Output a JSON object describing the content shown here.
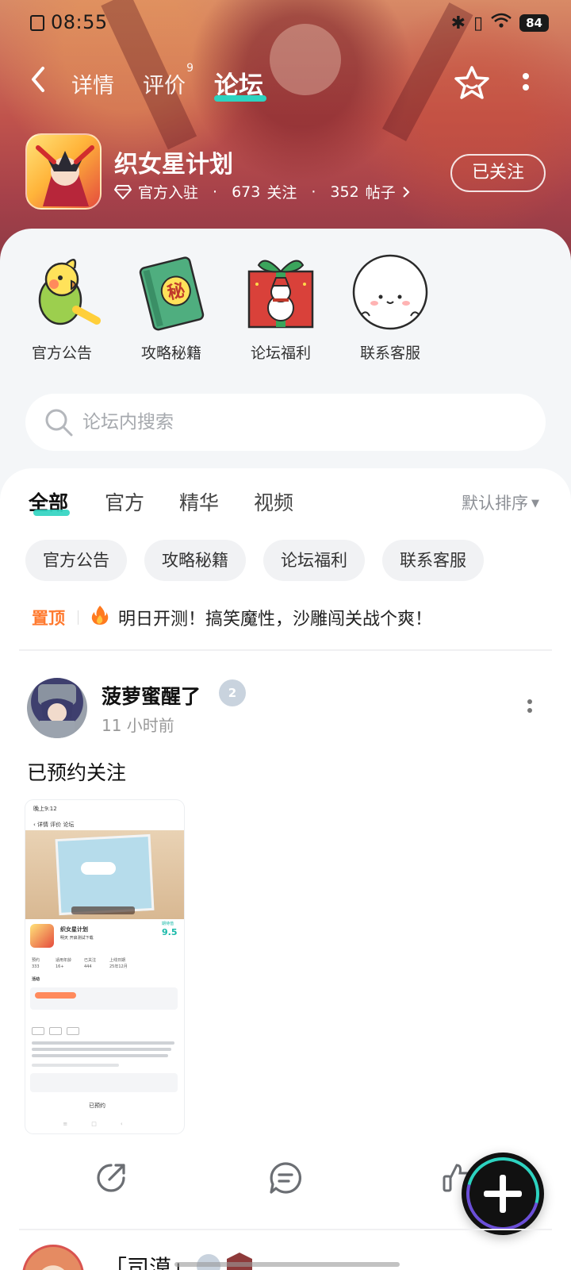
{
  "status_bar": {
    "time": "08:55",
    "battery": "84"
  },
  "header": {
    "tabs": [
      {
        "label": "详情"
      },
      {
        "label": "评价",
        "badge": "9"
      },
      {
        "label": "论坛"
      }
    ],
    "active_tab": "论坛",
    "accent_color": "#2dd3c0"
  },
  "game": {
    "name": "织女星计划",
    "official": "官方入驻",
    "followers": "673",
    "followers_label": "关注",
    "posts": "352",
    "posts_label": "帖子",
    "follow_button": "已关注"
  },
  "shortcuts": [
    {
      "label": "官方公告",
      "icon": "parrot-icon"
    },
    {
      "label": "攻略秘籍",
      "icon": "secret-book-icon"
    },
    {
      "label": "论坛福利",
      "icon": "gift-box-icon"
    },
    {
      "label": "联系客服",
      "icon": "ghost-icon"
    }
  ],
  "search": {
    "placeholder": "论坛内搜索"
  },
  "filter": {
    "tabs": [
      "全部",
      "官方",
      "精华",
      "视频"
    ],
    "active": "全部",
    "sort_label": "默认排序"
  },
  "chips": [
    "官方公告",
    "攻略秘籍",
    "论坛福利",
    "联系客服"
  ],
  "pinned": {
    "tag": "置顶",
    "text": "明日开测！搞笑魔性，沙雕闯关战个爽！"
  },
  "post": {
    "author": "菠萝蜜醒了",
    "level": "2",
    "time": "11 小时前",
    "title": "已预约关注",
    "screenshot": {
      "time": "晚上9:12",
      "tabs": [
        "详情",
        "评价",
        "论坛"
      ],
      "game_name": "织女星计划",
      "game_sub": "明天 开启测试下载",
      "score_label": "期待值",
      "score": "9.5",
      "stats": [
        {
          "label": "预约",
          "value": "333"
        },
        {
          "label": "适用年龄",
          "value": "16+"
        },
        {
          "label": "已关注",
          "value": "444"
        },
        {
          "label": "上线日期",
          "value": "25年12月"
        }
      ],
      "activity": "活动",
      "bottom_button": "已预约"
    }
  },
  "next_post": {
    "author": "「司漠」"
  }
}
